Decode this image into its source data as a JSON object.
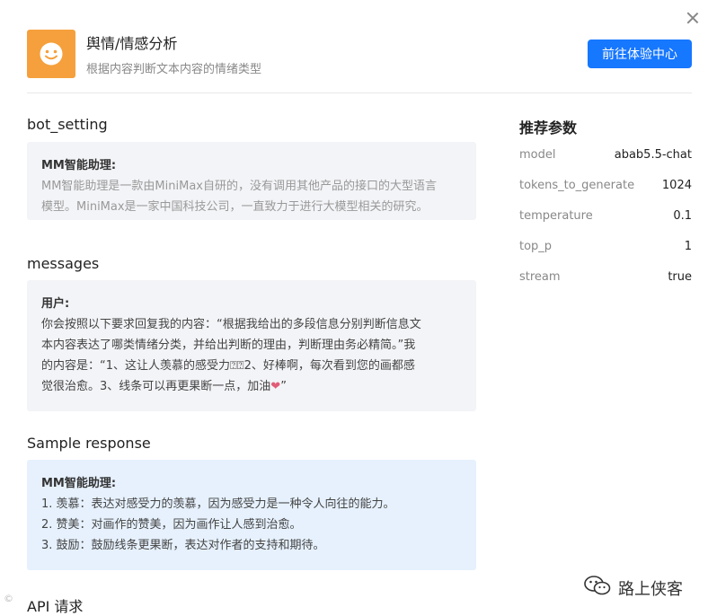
{
  "header": {
    "title": "舆情/情感分析",
    "description": "根据内容判断文本内容的情绪类型",
    "cta_label": "前往体验中心"
  },
  "sections": {
    "bot_setting": {
      "title": "bot_setting",
      "role": "MM智能助理:",
      "line1": "MM智能助理是一款由MiniMax自研的，没有调用其他产品的接口的大型语言",
      "line2": "模型。MiniMax是一家中国科技公司，一直致力于进行大模型相关的研究。"
    },
    "messages": {
      "title": "messages",
      "role": "用户:",
      "line1": "你会按照以下要求回复我的内容：“根据我给出的多段信息分别判断信息文",
      "line2": "本内容表达了哪类情绪分类，并给出判断的理由，判断理由务必精简。”我",
      "line3": "的内容是：“1、这让人羡慕的感受力⍰⍰2、好棒啊，每次看到您的画都感",
      "line4": "觉很治愈。3、线条可以再更果断一点，加油",
      "heart": "❤",
      "line4_end": "”"
    },
    "sample_response": {
      "title": "Sample response",
      "role": "MM智能助理:",
      "items": [
        "1. 羡慕：表达对感受力的羡慕，因为感受力是一种令人向往的能力。",
        "2. 赞美：对画作的赞美，因为画作让人感到治愈。",
        "3. 鼓励：鼓励线条更果断，表达对作者的支持和期待。"
      ]
    },
    "api": {
      "title": "API 请求"
    }
  },
  "params": {
    "title": "推荐参数",
    "rows": [
      {
        "key": "model",
        "value": "abab5.5-chat"
      },
      {
        "key": "tokens_to_generate",
        "value": "1024"
      },
      {
        "key": "temperature",
        "value": "0.1"
      },
      {
        "key": "top_p",
        "value": "1"
      },
      {
        "key": "stream",
        "value": "true"
      }
    ]
  },
  "watermark": {
    "text": "路上侠客",
    "icon": "wechat-icon"
  },
  "corner_mark": {
    "text": "©"
  }
}
